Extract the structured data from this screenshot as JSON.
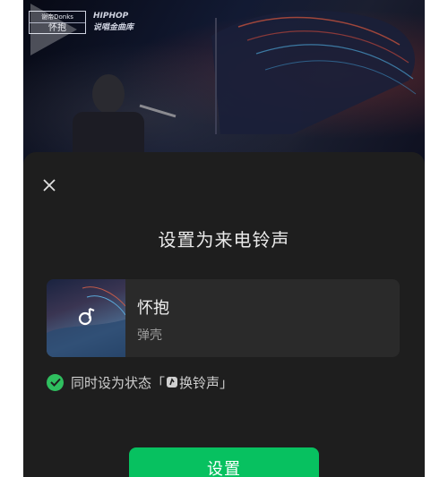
{
  "video": {
    "logo_top": "谢帝Donks",
    "logo_main": "怀抱",
    "logo_right_top": "HIPHOP",
    "logo_right_bottom": "说唱金曲库"
  },
  "sheet": {
    "title": "设置为来电铃声",
    "song": {
      "name": "怀抱",
      "artist": "弹壳"
    },
    "status_option": {
      "prefix": "同时设为状态「",
      "suffix": "换铃声」",
      "checked": true
    },
    "set_button": "设置"
  },
  "icons": [
    "close-icon",
    "play-icon",
    "ringtone-icon",
    "check-icon",
    "music-note-icon"
  ],
  "colors": {
    "sheet_bg": "#1e1e1e",
    "accent_green": "#07c160",
    "check_green": "#2fbf5f"
  }
}
